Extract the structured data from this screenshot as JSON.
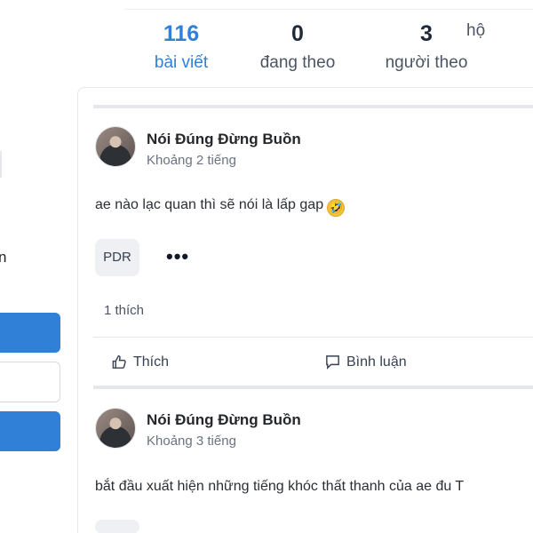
{
  "profile_stats": [
    {
      "value": "116",
      "label": "bài viết",
      "active": true
    },
    {
      "value": "0",
      "label": "đang theo",
      "active": false
    },
    {
      "value": "3",
      "label": "người theo",
      "active": false
    },
    {
      "value": "",
      "label": "hộ",
      "active": false
    }
  ],
  "left_panel": {
    "text": "n"
  },
  "posts": [
    {
      "author": "Nói Đúng Đừng Buồn",
      "time": "Khoảng 2 tiếng",
      "content": "ae nào lạc quan thì sẽ nói là lấp gap",
      "emoji": "🤣",
      "tag": "PDR",
      "more": "•••",
      "likes": "1 thích",
      "actions": {
        "like": "Thích",
        "comment": "Bình luận"
      }
    },
    {
      "author": "Nói Đúng Đừng Buồn",
      "time": "Khoảng 3 tiếng",
      "content": "bắt đầu xuất hiện những tiếng khóc thất thanh của ae đu T"
    }
  ],
  "colors": {
    "accent": "#2f80d6",
    "text": "#1f2937",
    "muted": "#6b7280",
    "border": "#e5e7eb"
  },
  "icons": [
    "thumbs-up-icon",
    "comment-icon",
    "more-options-icon",
    "laughing-emoji-icon"
  ]
}
